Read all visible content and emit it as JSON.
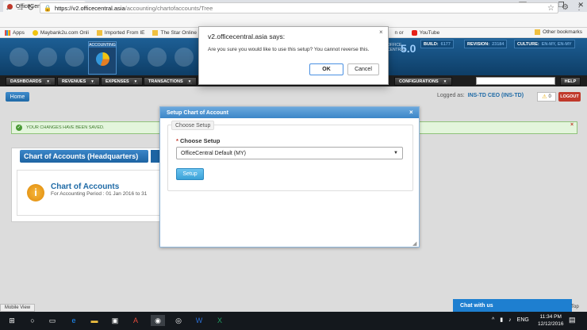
{
  "browser": {
    "tab_title": "OfficeCentral - Tree",
    "tab_close": "×",
    "back": "←",
    "forward": "→",
    "reload": "↻",
    "url_host": "https://v2.officecentral.asia",
    "url_path": "/accounting/chartofaccounts/Tree",
    "bookmarks": [
      "Apps",
      "Maybank2u.com Onli",
      "Imported From IE",
      "The Star Online |",
      "n or",
      "YouTube"
    ],
    "other_bookmarks": "Other bookmarks"
  },
  "header": {
    "accounting_label": "ACCOUNTING",
    "brand_text": "OFFICE\nCENTRAL",
    "brand_version": "5.0",
    "build_label": "BUILD:",
    "build_value": "6177",
    "revision_label": "REVISION:",
    "revision_value": "23184",
    "culture_label": "CULTURE:",
    "culture_value": "EN-MY, EN-MY"
  },
  "nav": {
    "items": [
      "DASHBOARDS",
      "REVENUES",
      "EXPENSES",
      "TRANSACTIONS",
      "CONFIGURATIONS"
    ],
    "help": "HELP",
    "dropdown_glyph": "▾"
  },
  "page": {
    "home": "Home",
    "logged_as_label": "Logged as:",
    "logged_as_user": "INS-TD CEO (INS-TD)",
    "warnings_count": "0",
    "logout": "LOGOUT",
    "alert_message": "YOUR CHANGES HAVE BEEN SAVED.",
    "panel_title": "Chart of Accounts (Headquarters)",
    "coa_title": "Chart of Accounts",
    "coa_period": "For Accounting Period : 01 Jan 2016 to 31"
  },
  "modal": {
    "title": "Setup Chart of Account",
    "legend": "Choose Setup",
    "field_label": "Choose Setup",
    "required_mark": "*",
    "selected_option": "OfficeCentral Default (MY)",
    "setup_button": "Setup"
  },
  "confirm": {
    "title": "v2.officecentral.asia says:",
    "message": "Are you sure you would like to use this setup? You cannot reverse this.",
    "ok": "OK",
    "cancel": "Cancel"
  },
  "footer": {
    "mobile_view": "Mobile View",
    "chat": "Chat with us",
    "to_top": "Top"
  },
  "taskbar": {
    "lang": "ENG",
    "time": "11:34 PM",
    "date": "12/12/2016"
  }
}
